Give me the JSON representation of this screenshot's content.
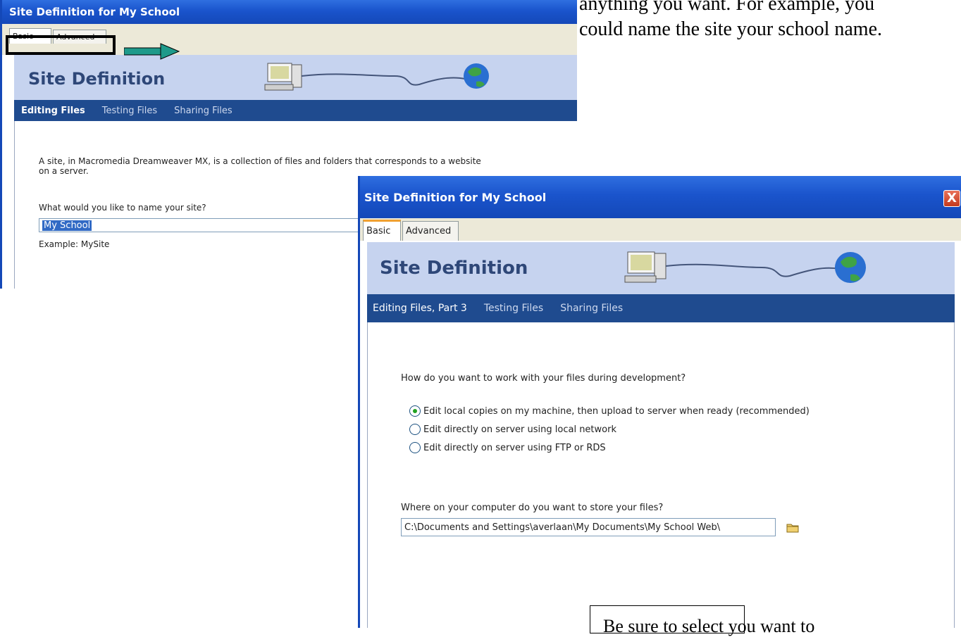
{
  "annotation": {
    "line1": "anything you want. For example, you",
    "line2": "could name the site your school name.",
    "bottom_box": "Be sure to select you want to"
  },
  "window_back": {
    "title": "Site Definition for My School",
    "tabs": [
      "Basic",
      "Advanced"
    ],
    "banner_title": "Site Definition",
    "subnav": [
      "Editing Files",
      "Testing Files",
      "Sharing Files"
    ],
    "intro_line1": "A site, in Macromedia Dreamweaver MX, is a collection of files and folders that corresponds to a website",
    "intro_line2": "on a server.",
    "question": "What would you like to name your site?",
    "site_name_value": "My School",
    "example": "Example: MySite"
  },
  "window_front": {
    "title": "Site Definition for My School",
    "close_label": "X",
    "tabs": [
      "Basic",
      "Advanced"
    ],
    "banner_title": "Site Definition",
    "subnav": [
      "Editing Files, Part 3",
      "Testing Files",
      "Sharing Files"
    ],
    "question": "How do you want to work with your files during development?",
    "options": [
      {
        "label": "Edit local copies on my machine, then upload to server when ready (recommended)",
        "checked": true
      },
      {
        "label": "Edit directly on server using local network",
        "checked": false
      },
      {
        "label": "Edit directly on server using FTP or RDS",
        "checked": false
      }
    ],
    "folder_question": "Where on your computer do you want to store your files?",
    "folder_path": "C:\\Documents and Settings\\averlaan\\My Documents\\My School Web\\"
  },
  "colors": {
    "titlebar": "#1a54cc",
    "banner": "#c6d3ef",
    "subnav": "#1f4b8f",
    "arrow": "#1e9a8a"
  }
}
